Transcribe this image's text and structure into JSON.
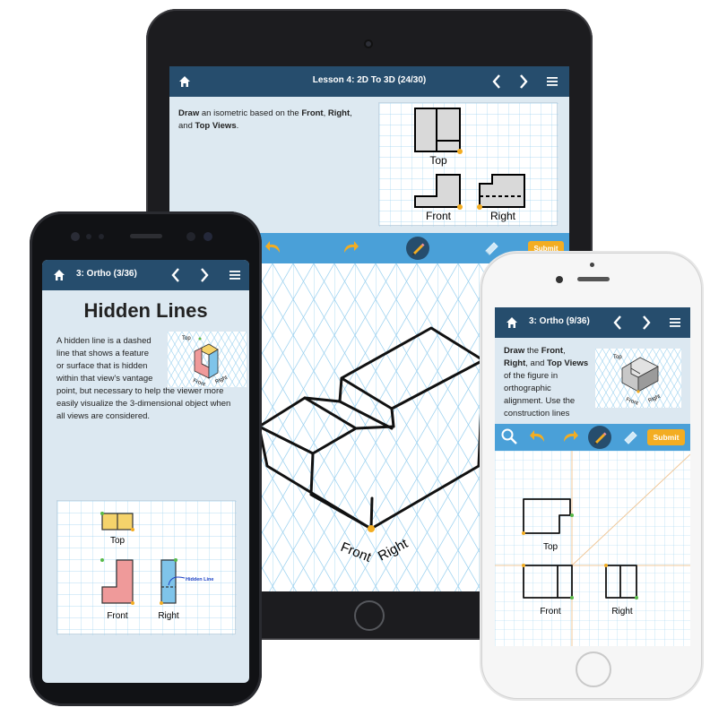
{
  "tablet": {
    "header": {
      "home_icon": "home-icon",
      "title": "Lesson 4: 2D To 3D (24/30)",
      "prev_icon": "chevron-left-icon",
      "next_icon": "chevron-right-icon",
      "menu_icon": "menu-icon"
    },
    "instruction": {
      "verb": "Draw",
      "part1": " an isometric based on the ",
      "front": "Front",
      "sep1": ", ",
      "right": "Right",
      "sep2": ",",
      "and": "and ",
      "top": "Top Views",
      "end": "."
    },
    "reference": {
      "top_label": "Top",
      "front_label": "Front",
      "right_label": "Right"
    },
    "toolbar": {
      "undo_icon": "undo-icon",
      "redo_icon": "redo-icon",
      "pencil_icon": "pencil-icon",
      "eraser_icon": "eraser-icon",
      "submit_label": "Submit"
    },
    "canvas": {
      "front_label": "Front",
      "right_label": "Right"
    }
  },
  "android": {
    "header": {
      "home_icon": "home-icon",
      "title": "3: Ortho (3/36)",
      "prev_icon": "chevron-left-icon",
      "next_icon": "chevron-right-icon",
      "menu_icon": "menu-icon"
    },
    "page_title": "Hidden Lines",
    "body_first": "A hidden line is a dashed line that shows a feature or surface that is hidden within that view's vantage",
    "body_rest": "point, but necessary to help the viewer more easily visualize the 3-dimensional object when all views are considered.",
    "reference": {
      "top_label": "Top",
      "front_label": "Front",
      "right_label": "Right"
    },
    "diagram": {
      "top_label": "Top",
      "front_label": "Front",
      "right_label": "Right",
      "hidden_line_label": "Hidden Line"
    }
  },
  "iphone": {
    "header": {
      "home_icon": "home-icon",
      "title": "3: Ortho (9/36)",
      "prev_icon": "chevron-left-icon",
      "next_icon": "chevron-right-icon",
      "menu_icon": "menu-icon"
    },
    "instruction": {
      "verb": "Draw",
      "part1": " the ",
      "front": "Front",
      "sep1": ", ",
      "right": "Right",
      "part2": ", and ",
      "top": "Top",
      "views": "Views",
      "rest": " of the figure in orthographic alignment. Use the construction lines"
    },
    "reference": {
      "top_label": "Top",
      "front_label": "Front",
      "right_label": "Right"
    },
    "toolbar": {
      "search_icon": "magnifier-icon",
      "undo_icon": "undo-icon",
      "redo_icon": "redo-icon",
      "pencil_icon": "pencil-icon",
      "eraser_icon": "eraser-icon",
      "submit_label": "Submit"
    },
    "canvas": {
      "top_label": "Top",
      "front_label": "Front",
      "right_label": "Right"
    }
  },
  "colors": {
    "header": "#264d6d",
    "toolbar": "#4aa0d8",
    "submit": "#f3ad22",
    "grid": "#9fd3f0",
    "panel": "#dde9f1"
  }
}
